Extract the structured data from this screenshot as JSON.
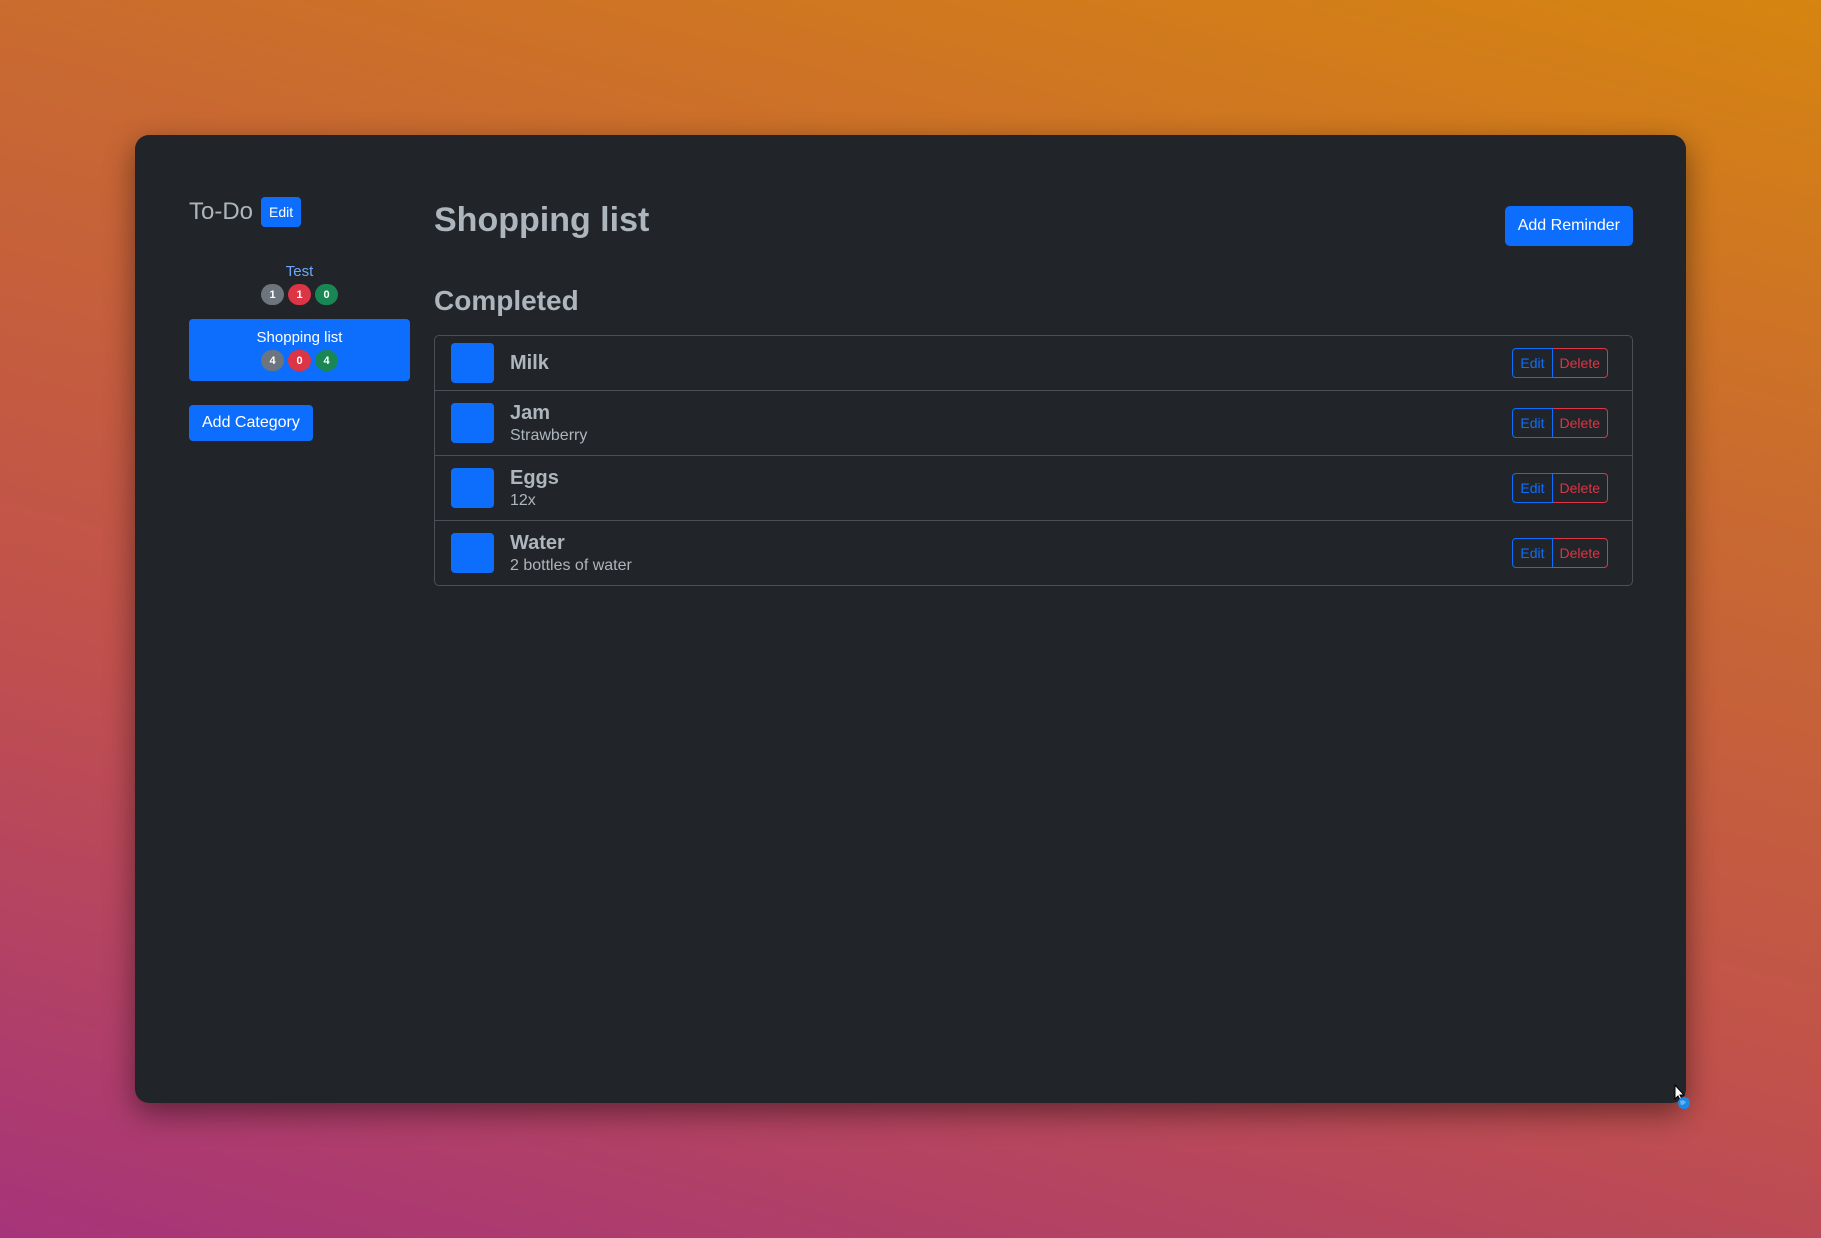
{
  "sidebar": {
    "title": "To-Do",
    "edit_label": "Edit",
    "categories": [
      {
        "name": "Test",
        "counts": [
          "1",
          "1",
          "0"
        ]
      },
      {
        "name": "Shopping list",
        "counts": [
          "4",
          "0",
          "4"
        ]
      }
    ],
    "add_category_label": "Add Category"
  },
  "main": {
    "title": "Shopping list",
    "add_reminder_label": "Add Reminder",
    "section_title": "Completed",
    "items": [
      {
        "title": "Milk",
        "subtitle": ""
      },
      {
        "title": "Jam",
        "subtitle": "Strawberry"
      },
      {
        "title": "Eggs",
        "subtitle": "12x"
      },
      {
        "title": "Water",
        "subtitle": "2 bottles of water"
      }
    ],
    "edit_label": "Edit",
    "delete_label": "Delete"
  },
  "colors": {
    "primary": "#0d6efd",
    "danger": "#dc3545",
    "success": "#198754",
    "secondary": "#6c757d",
    "window_bg": "#212529"
  }
}
